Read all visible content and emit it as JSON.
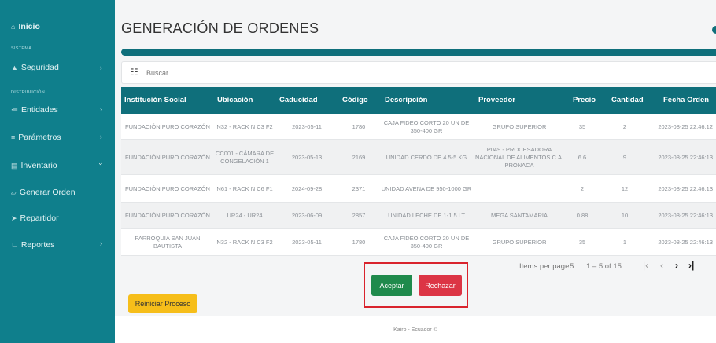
{
  "sidebar": {
    "home": {
      "label": "Inicio",
      "icon": "home-icon"
    },
    "section_system": "SISTEMA",
    "security": {
      "label": "Seguridad",
      "icon": "lock-icon"
    },
    "section_distribution": "DISTRIBUCIÓN",
    "entities": {
      "label": "Entidades",
      "icon": "users-icon"
    },
    "parameters": {
      "label": "Parámetros",
      "icon": "cog-icon"
    },
    "inventory": {
      "label": "Inventario",
      "icon": "list-icon"
    },
    "generate": {
      "label": "Generar Orden",
      "icon": "order-icon"
    },
    "deliverer": {
      "label": "Repartidor",
      "icon": "send-icon"
    },
    "reports": {
      "label": "Reportes",
      "icon": "chart-icon"
    }
  },
  "header": {
    "title": "GENERACIÓN DE ORDENES"
  },
  "search": {
    "placeholder": "Buscar..."
  },
  "table": {
    "columns": [
      "Institución Social",
      "Ubicación",
      "Caducidad",
      "Código",
      "Descripción",
      "Proveedor",
      "Precio",
      "Cantidad",
      "Fecha Orden"
    ],
    "rows": [
      {
        "institucion": "FUNDACIÓN PURO CORAZÓN",
        "ubicacion": "N32 - RACK N C3 F2",
        "caducidad": "2023-05-11",
        "codigo": "1780",
        "descripcion": "CAJA FIDEO CORTO 20 UN DE 350-400 GR",
        "proveedor": "GRUPO SUPERIOR",
        "precio": "35",
        "cantidad": "2",
        "fecha": "2023-08-25 22:46:12"
      },
      {
        "institucion": "FUNDACIÓN PURO CORAZÓN",
        "ubicacion": "CC001 - CÁMARA DE CONGELACIÓN 1",
        "caducidad": "2023-05-13",
        "codigo": "2169",
        "descripcion": "UNIDAD CERDO DE 4.5-5 KG",
        "proveedor": "P049 - PROCESADORA NACIONAL DE ALIMENTOS C.A. PRONACA",
        "precio": "6.6",
        "cantidad": "9",
        "fecha": "2023-08-25 22:46:13"
      },
      {
        "institucion": "FUNDACIÓN PURO CORAZÓN",
        "ubicacion": "N61 - RACK N C6 F1",
        "caducidad": "2024-09-28",
        "codigo": "2371",
        "descripcion": "UNIDAD AVENA DE 950-1000 GR",
        "proveedor": "",
        "precio": "2",
        "cantidad": "12",
        "fecha": "2023-08-25 22:46:13"
      },
      {
        "institucion": "FUNDACIÓN PURO CORAZÓN",
        "ubicacion": "UR24 - UR24",
        "caducidad": "2023-06-09",
        "codigo": "2857",
        "descripcion": "UNIDAD LECHE DE 1-1.5 LT",
        "proveedor": "MEGA SANTAMARIA",
        "precio": "0.88",
        "cantidad": "10",
        "fecha": "2023-08-25 22:46:13"
      },
      {
        "institucion": "PARROQUIA SAN JUAN BAUTISTA",
        "ubicacion": "N32 - RACK N C3 F2",
        "caducidad": "2023-05-11",
        "codigo": "1780",
        "descripcion": "CAJA FIDEO CORTO 20 UN DE 350-400 GR",
        "proveedor": "GRUPO SUPERIOR",
        "precio": "35",
        "cantidad": "1",
        "fecha": "2023-08-25 22:46:13"
      }
    ]
  },
  "pagination": {
    "items_label": "Items per page:",
    "page_size": "5",
    "range": "1 – 5 of 15"
  },
  "actions": {
    "accept": "Aceptar",
    "reject": "Rechazar",
    "restart": "Reiniciar Proceso"
  },
  "footer": {
    "text": "Kairo - Ecuador ©"
  },
  "colors": {
    "sidebar": "#0f7f8c",
    "header": "#0f6f7b",
    "accept": "#1f8a4c",
    "reject": "#dc3545",
    "restart": "#f6be1a"
  }
}
